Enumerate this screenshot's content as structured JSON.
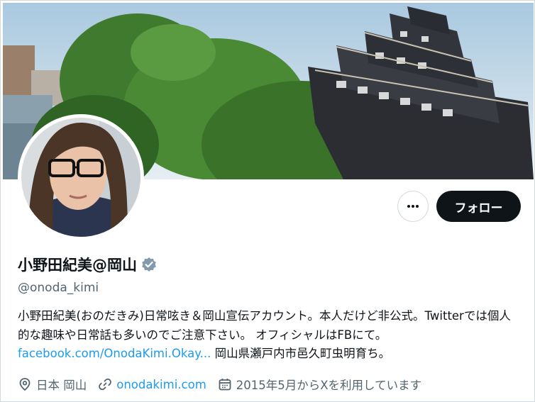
{
  "profile": {
    "display_name": "小野田紀美@岡山",
    "handle": "@onoda_kimi",
    "bio_text": "小野田紀美(おのだきみ)日常呟き＆岡山宣伝アカウント。本人だけど非公式。Twitterでは個人的な趣味や日常話も多いのでご注意下さい。 オフィシャルはFBにて。",
    "bio_link": "facebook.com/OnodaKimi.Okay...",
    "bio_suffix": " 岡山県瀬戸内市邑久町虫明育ち。",
    "location": "日本 岡山",
    "website": "onodakimi.com",
    "joined": "2015年5月からXを利用しています"
  },
  "actions": {
    "more_icon": "more-horizontal-icon",
    "follow_label": "フォロー"
  },
  "colors": {
    "accent": "#1d9bf0",
    "text": "#0f1419",
    "muted": "#536471",
    "button_dark": "#0f1419"
  },
  "icons": {
    "verified": "verified-badge-icon",
    "location": "location-pin-icon",
    "website": "link-icon",
    "joined": "calendar-icon"
  }
}
